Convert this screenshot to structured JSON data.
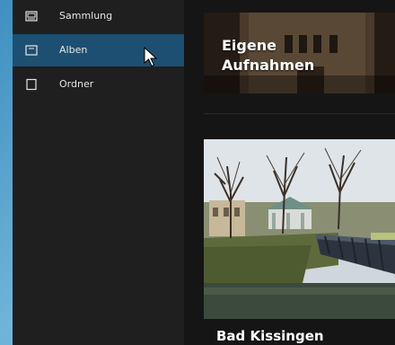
{
  "sidebar": {
    "items": [
      {
        "label": "Sammlung",
        "icon": "collection-icon"
      },
      {
        "label": "Alben",
        "icon": "album-icon",
        "selected": true
      },
      {
        "label": "Ordner",
        "icon": "folder-icon"
      }
    ]
  },
  "albums": [
    {
      "title": "Eigene\nAufnahmen"
    },
    {
      "title": "Bad Kissingen"
    }
  ],
  "colors": {
    "selected_nav": "#1d4f72",
    "sidebar_bg": "#1f1f1f",
    "content_bg": "#151515",
    "text": "#e6e6e6"
  }
}
